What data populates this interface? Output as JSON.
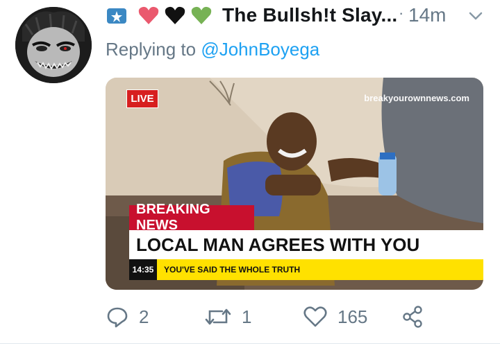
{
  "tweet": {
    "author_name": "The Bullsh!t Slay...",
    "separator": "·",
    "time": "14m",
    "reply_prefix": "Replying to",
    "reply_handle": "@JohnBoyega",
    "emoji_icons": [
      "blue-star-badge-icon",
      "pink-heart-icon",
      "black-heart-icon",
      "green-heart-icon"
    ]
  },
  "media": {
    "live_label": "LIVE",
    "watermark": "breakyourownnews.com",
    "breaking_label": "BREAKING NEWS",
    "headline": "LOCAL MAN AGREES WITH YOU",
    "ticker_time": "14:35",
    "ticker_text": "YOU'VE SAID THE WHOLE TRUTH"
  },
  "actions": {
    "reply_count": "2",
    "retweet_count": "1",
    "like_count": "165",
    "icons": [
      "reply-icon",
      "retweet-icon",
      "like-icon",
      "share-icon"
    ]
  },
  "colors": {
    "brand_blue": "#1da1f2",
    "secondary_text": "#657786",
    "primary_text": "#14171a",
    "breaking_red": "#c8102e",
    "ticker_yellow": "#ffe100"
  }
}
